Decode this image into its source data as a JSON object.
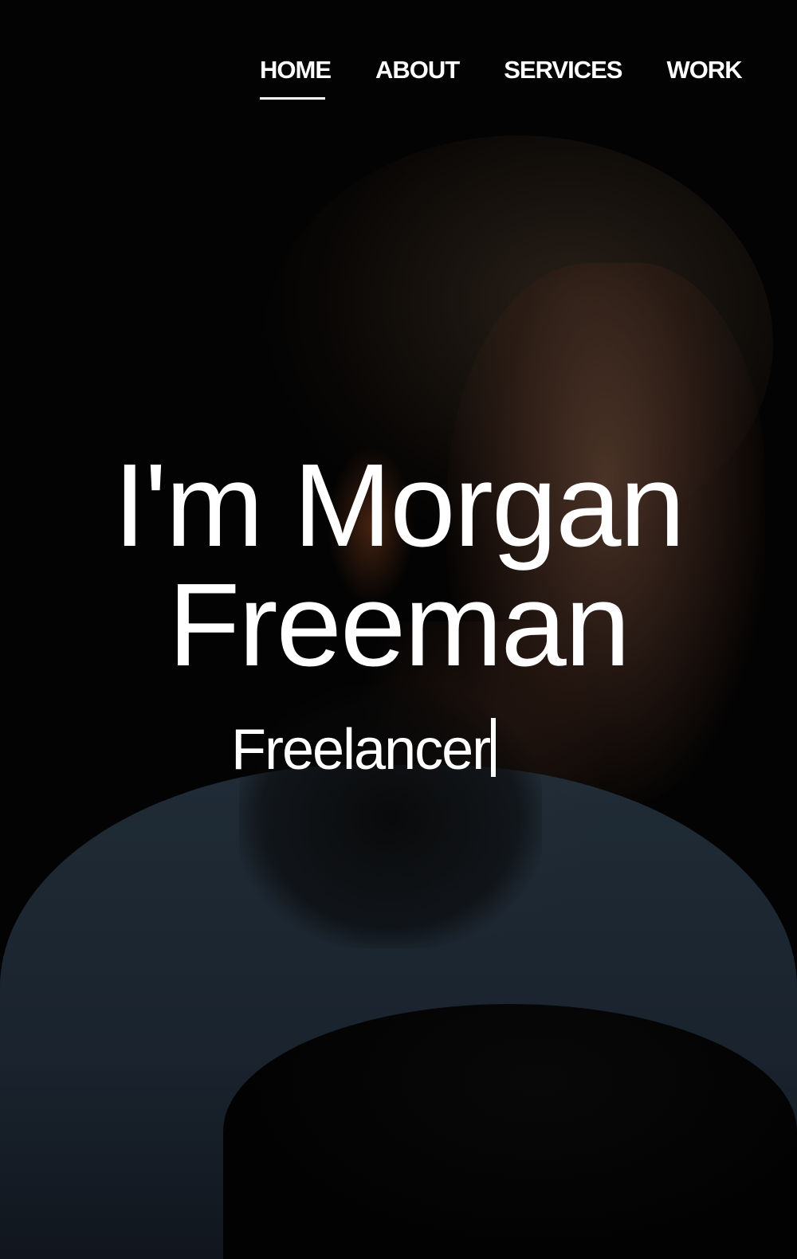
{
  "nav": {
    "items": [
      {
        "label": "HOME",
        "active": true
      },
      {
        "label": "ABOUT",
        "active": false
      },
      {
        "label": "SERVICES",
        "active": false
      },
      {
        "label": "WORK",
        "active": false
      }
    ]
  },
  "hero": {
    "title": "I'm Morgan Freeman",
    "subtitle": "Freelancer",
    "text_color": "#ffffff"
  }
}
